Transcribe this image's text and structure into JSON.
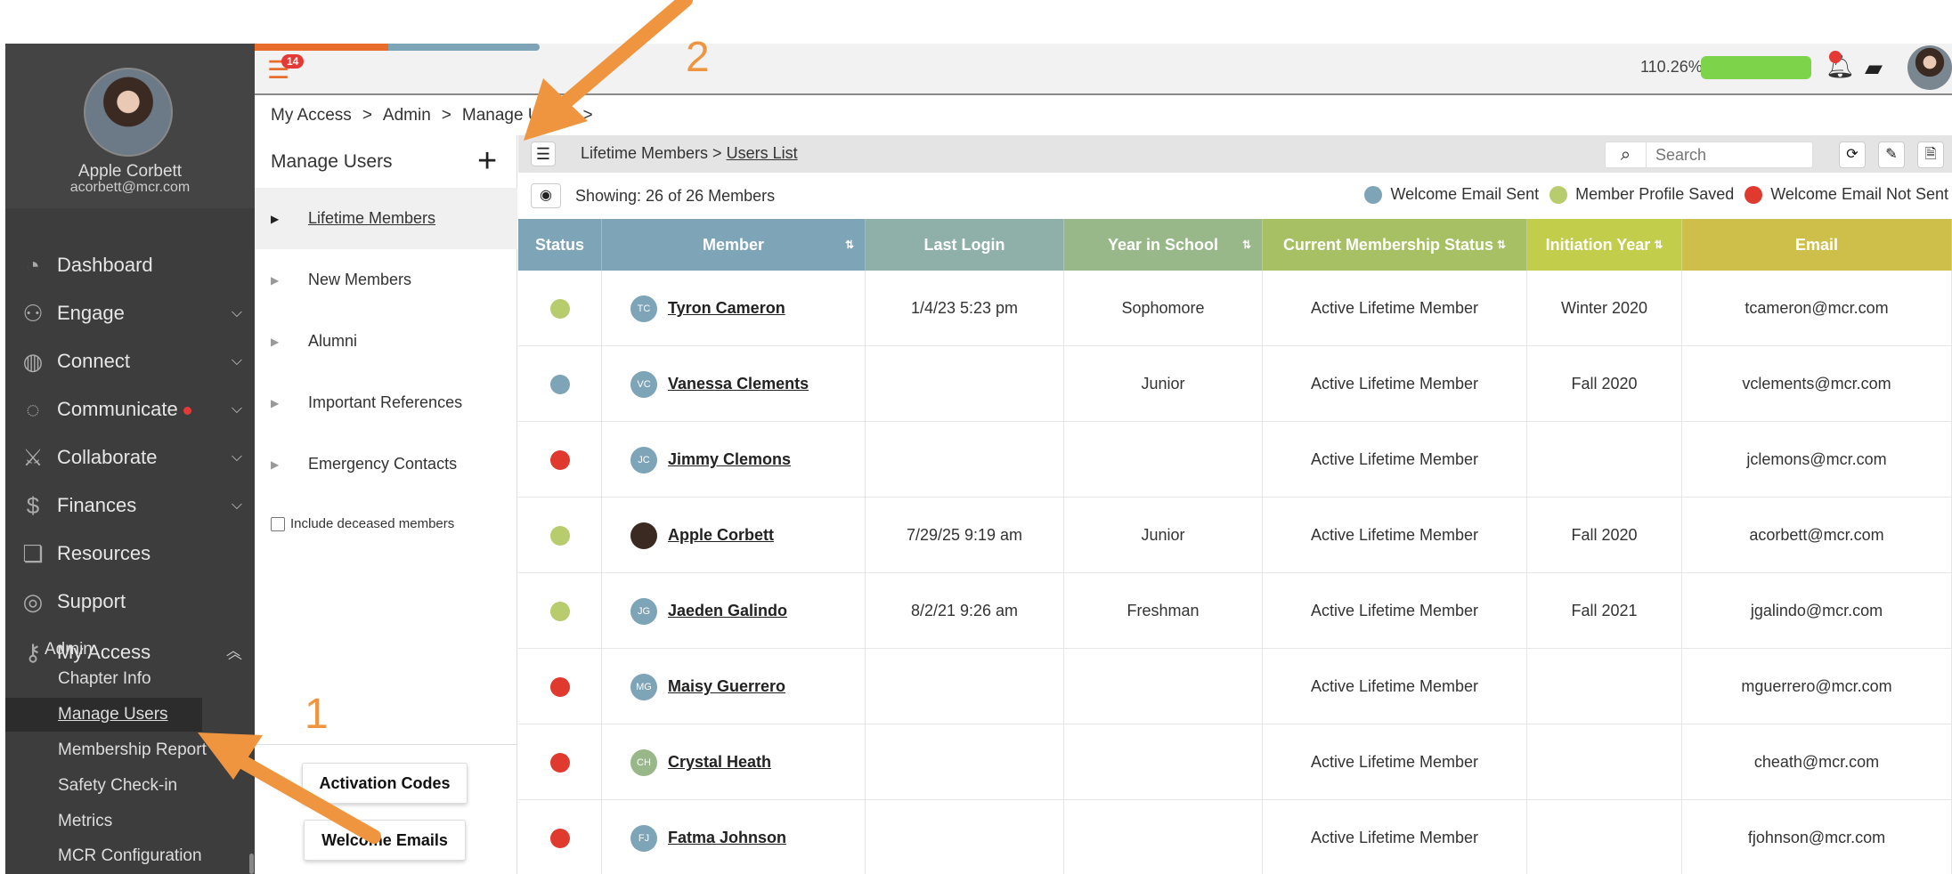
{
  "profile": {
    "name": "Apple Corbett",
    "email": "acorbett@mcr.com"
  },
  "sidebar": {
    "items": [
      {
        "label": "Dashboard",
        "icon": "dashboard-icon",
        "glyph": "◔",
        "chevron": "",
        "dot": false
      },
      {
        "label": "Engage",
        "icon": "engage-icon",
        "glyph": "⚇",
        "chevron": "⌵",
        "dot": false
      },
      {
        "label": "Connect",
        "icon": "globe-icon",
        "glyph": "◍",
        "chevron": "⌵",
        "dot": false
      },
      {
        "label": "Communicate",
        "icon": "chat-icon",
        "glyph": "◌",
        "chevron": "⌵",
        "dot": true
      },
      {
        "label": "Collaborate",
        "icon": "collaborate-icon",
        "glyph": "⚔",
        "chevron": "⌵",
        "dot": false
      },
      {
        "label": "Finances",
        "icon": "dollar-icon",
        "glyph": "$",
        "chevron": "⌵",
        "dot": false
      },
      {
        "label": "Resources",
        "icon": "book-icon",
        "glyph": "❏",
        "chevron": "",
        "dot": false
      },
      {
        "label": "Support",
        "icon": "support-icon",
        "glyph": "◎",
        "chevron": "",
        "dot": false
      },
      {
        "label": "My Access",
        "icon": "key-icon",
        "glyph": "⚷",
        "chevron": "︿",
        "dot": false
      }
    ],
    "admin_label": "Admin",
    "sub_items": [
      "Chapter Info",
      "Manage Users",
      "Membership Report",
      "Safety Check-in",
      "Metrics",
      "MCR Configuration"
    ]
  },
  "topbar": {
    "notification_count": "14",
    "percent": "110.26%"
  },
  "breadcrumb": [
    "My Access",
    ">",
    "Admin",
    ">",
    "Manage Users",
    ">"
  ],
  "panel": {
    "title": "Manage Users",
    "plus": "+",
    "lists": [
      "Lifetime Members",
      "New Members",
      "Alumni",
      "Important References",
      "Emergency Contacts"
    ],
    "deceased_label": "Include deceased members",
    "activation_btn": "Activation Codes",
    "welcome_btn": "Welcome Emails"
  },
  "toolbar": {
    "crumb_root": "Lifetime Members >",
    "crumb_current": "Users List",
    "search_placeholder": "Search"
  },
  "showing": "Showing: 26 of 26 Members",
  "legend": [
    {
      "label": "Welcome Email Sent",
      "color": "#7ea4b8"
    },
    {
      "label": "Member Profile Saved",
      "color": "#b7cc6c"
    },
    {
      "label": "Welcome Email Not Sent",
      "color": "#e0392e"
    }
  ],
  "columns": [
    {
      "label": "Status",
      "color": "#7ea4b8",
      "sort": ""
    },
    {
      "label": "Member",
      "color": "#7ea4b8",
      "sort": "⇅"
    },
    {
      "label": "Last Login",
      "color": "#8fb0a9",
      "sort": ""
    },
    {
      "label": "Year in School",
      "color": "#99b88a",
      "sort": "⇅"
    },
    {
      "label": "Current Membership Status",
      "color": "#a6c063",
      "sort": "⇅"
    },
    {
      "label": "Initiation Year",
      "color": "#c3cd4c",
      "sort": "⇅"
    },
    {
      "label": "Email",
      "color": "#cdbf4a",
      "sort": ""
    }
  ],
  "rows": [
    {
      "status": "#b7cc6c",
      "initials": "TC",
      "init_color": "#7ea4b8",
      "name": "Tyron Cameron",
      "login": "1/4/23 5:23 pm",
      "year": "Sophomore",
      "membership": "Active Lifetime Member",
      "init_year": "Winter 2020",
      "email": "tcameron@mcr.com"
    },
    {
      "status": "#7ea4b8",
      "initials": "VC",
      "init_color": "#7ea4b8",
      "name": "Vanessa Clements",
      "login": "",
      "year": "Junior",
      "membership": "Active Lifetime Member",
      "init_year": "Fall 2020",
      "email": "vclements@mcr.com"
    },
    {
      "status": "#e0392e",
      "initials": "JC",
      "init_color": "#7ea4b8",
      "name": "Jimmy Clemons",
      "login": "",
      "year": "",
      "membership": "Active Lifetime Member",
      "init_year": "",
      "email": "jclemons@mcr.com"
    },
    {
      "status": "#b7cc6c",
      "initials": "",
      "init_color": "#3a2a22",
      "name": "Apple Corbett",
      "login": "7/29/25 9:19 am",
      "year": "Junior",
      "membership": "Active Lifetime Member",
      "init_year": "Fall 2020",
      "email": "acorbett@mcr.com"
    },
    {
      "status": "#b7cc6c",
      "initials": "JG",
      "init_color": "#7ea4b8",
      "name": "Jaeden Galindo",
      "login": "8/2/21 9:26 am",
      "year": "Freshman",
      "membership": "Active Lifetime Member",
      "init_year": "Fall 2021",
      "email": "jgalindo@mcr.com"
    },
    {
      "status": "#e0392e",
      "initials": "MG",
      "init_color": "#7ea4b8",
      "name": "Maisy Guerrero",
      "login": "",
      "year": "",
      "membership": "Active Lifetime Member",
      "init_year": "",
      "email": "mguerrero@mcr.com"
    },
    {
      "status": "#e0392e",
      "initials": "CH",
      "init_color": "#99b88a",
      "name": "Crystal Heath",
      "login": "",
      "year": "",
      "membership": "Active Lifetime Member",
      "init_year": "",
      "email": "cheath@mcr.com"
    },
    {
      "status": "#e0392e",
      "initials": "FJ",
      "init_color": "#7ea4b8",
      "name": "Fatma Johnson",
      "login": "",
      "year": "",
      "membership": "Active Lifetime Member",
      "init_year": "",
      "email": "fjohnson@mcr.com"
    }
  ],
  "annotations": {
    "one": "1",
    "two": "2",
    "arrow_color": "#f0953f"
  }
}
